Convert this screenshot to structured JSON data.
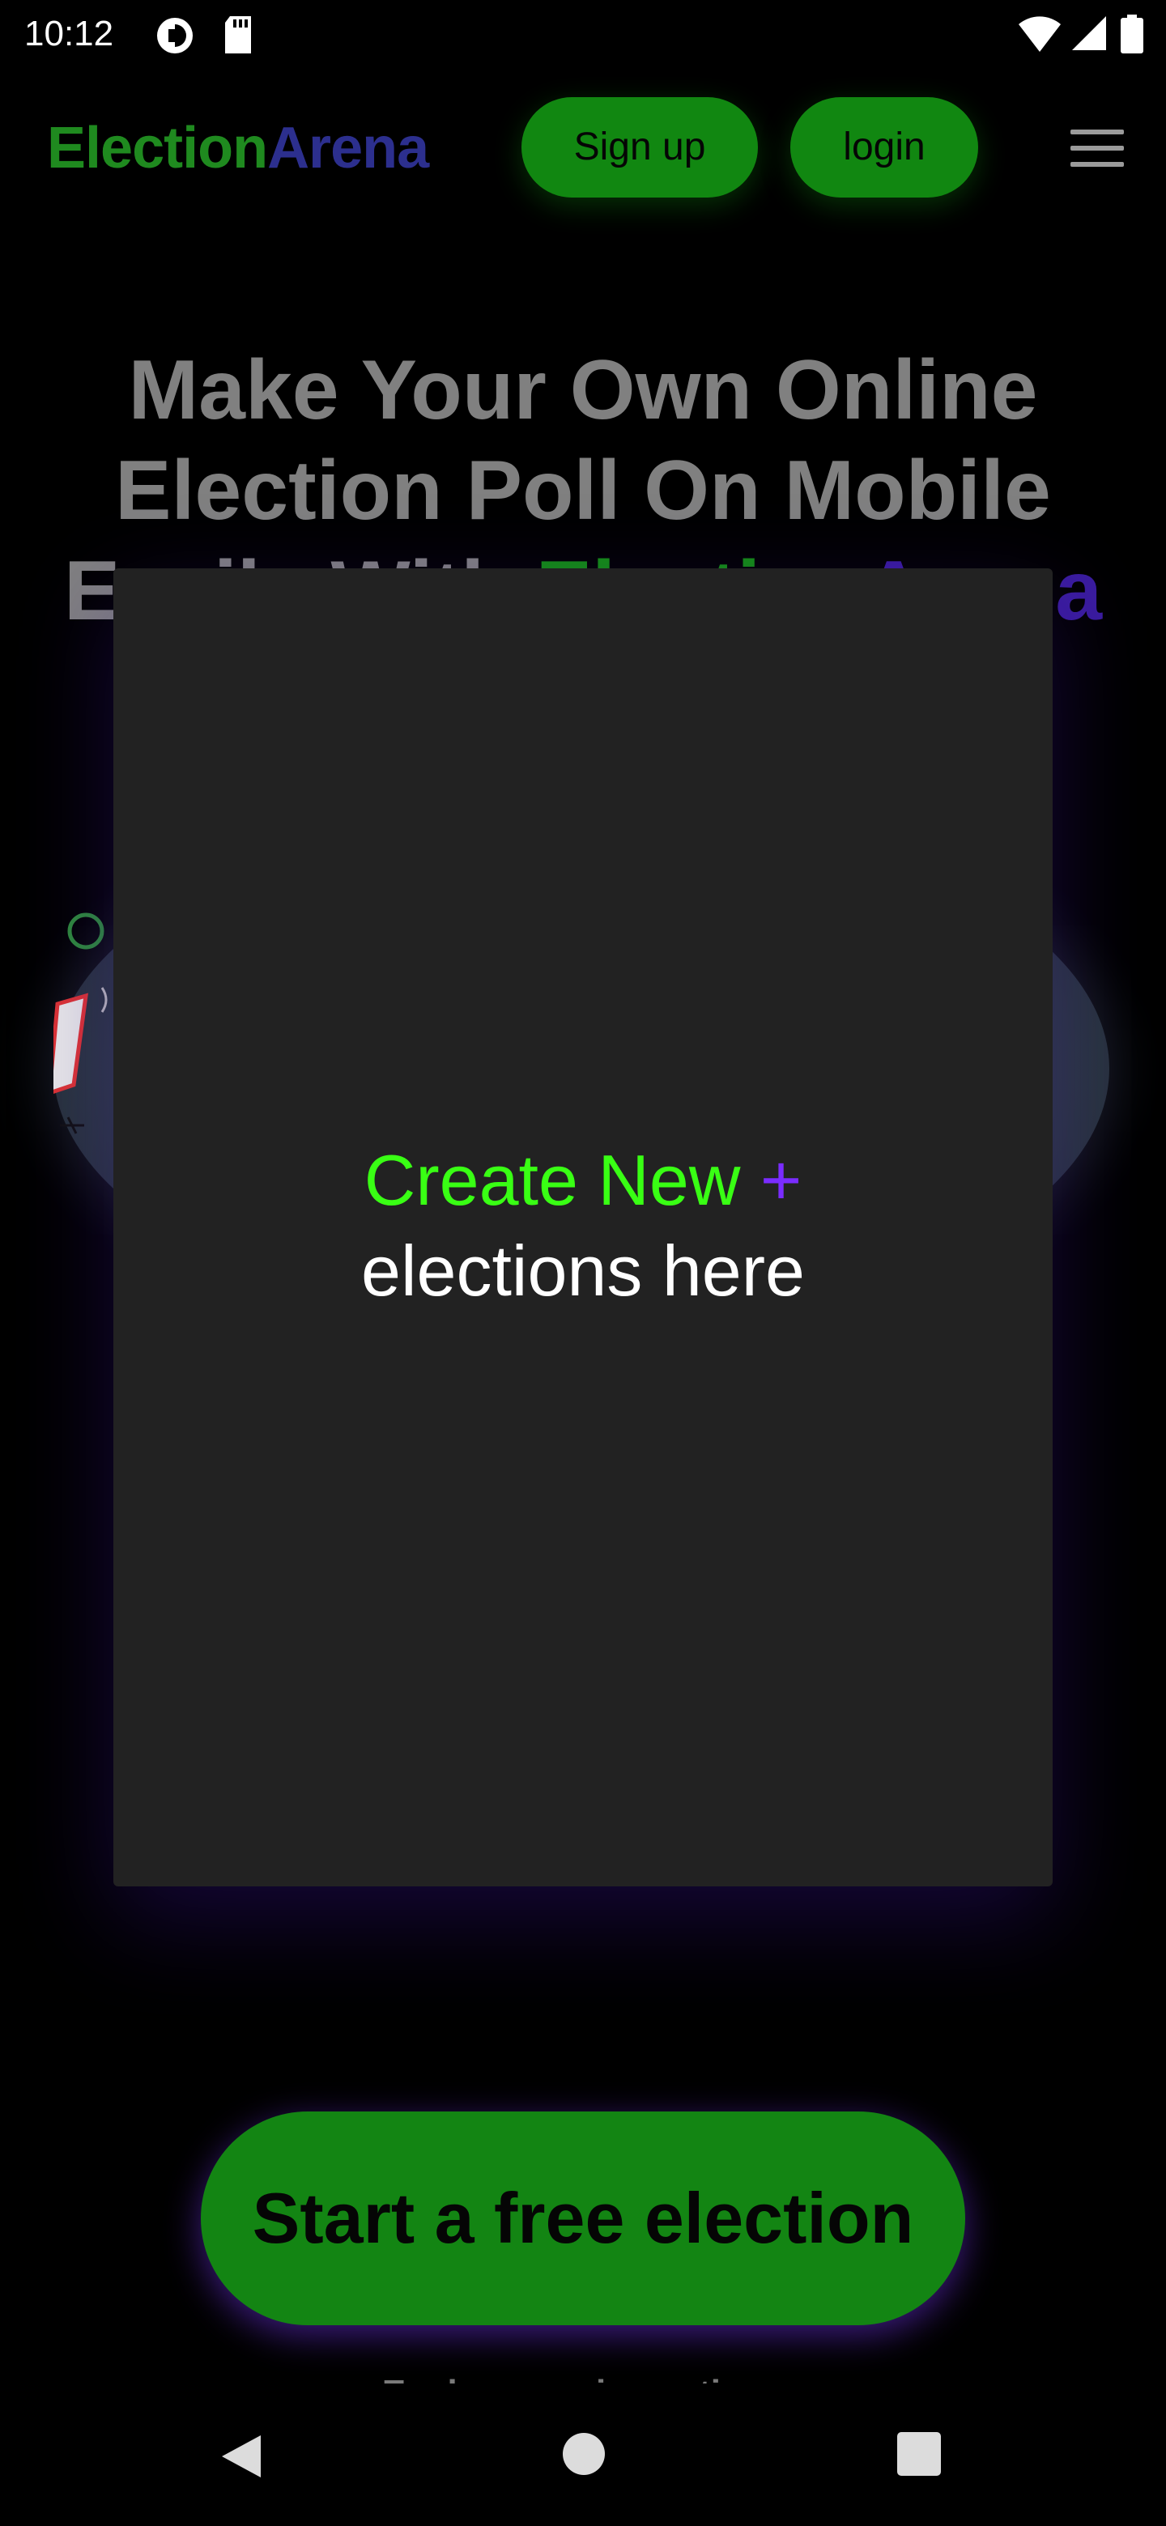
{
  "status_bar": {
    "time": "10:12",
    "icons": [
      "notification-circle-icon",
      "sd-card-icon",
      "wifi-icon",
      "cell-signal-icon",
      "battery-icon"
    ]
  },
  "header": {
    "brand_part1": "Election",
    "brand_part2": "Arena",
    "signup_label": "Sign up",
    "login_label": "login",
    "menu_icon": "hamburger-menu-icon"
  },
  "hero": {
    "line1": "Make Your Own Online",
    "line2": "Election Poll On Mobile",
    "line3_prefix": "Easily With ",
    "line3_green": "Election",
    "line3_purple": "Arena"
  },
  "modal": {
    "create_label": "Create New",
    "plus_symbol": "+",
    "subtitle": "elections here"
  },
  "cta": {
    "start_label": "Start a free election",
    "explore_label": "Explore service options"
  },
  "nav_bar": {
    "icons": [
      "back-icon",
      "home-icon",
      "recents-icon"
    ]
  },
  "colors": {
    "brand_green": "#138513",
    "accent_green": "#39ff14",
    "accent_purple": "#7a2cff",
    "card_background": "#222222"
  }
}
